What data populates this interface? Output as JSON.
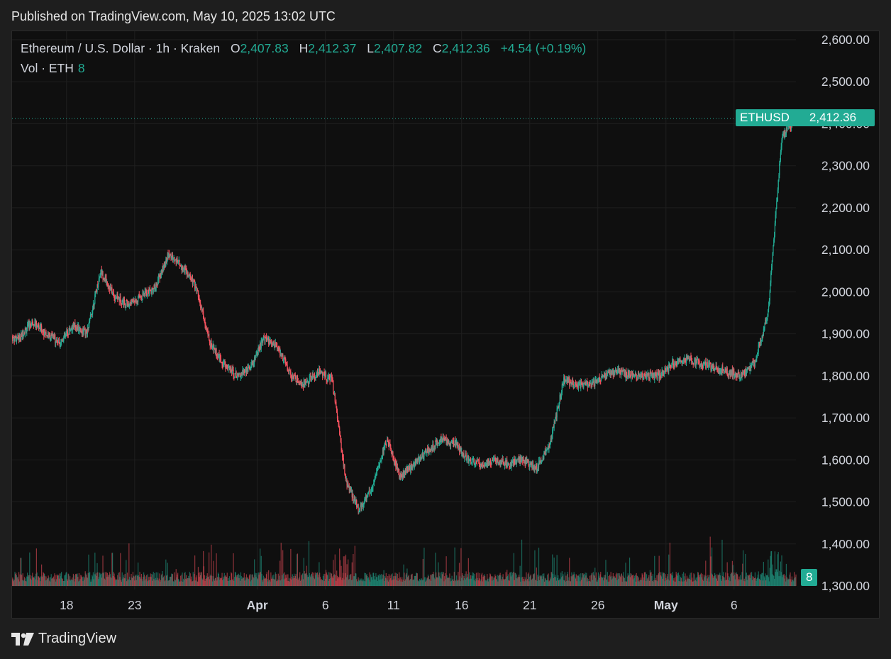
{
  "header": {
    "published_text": "Published on TradingView.com, May 10, 2025 13:02 UTC"
  },
  "legend": {
    "symbol_line": "Ethereum / U.S. Dollar · 1h · Kraken",
    "open_label": "O",
    "open": "2,407.83",
    "high_label": "H",
    "high": "2,412.37",
    "low_label": "L",
    "low": "2,407.82",
    "close_label": "C",
    "close": "2,412.36",
    "change": "+4.54 (+0.19%)",
    "volume_label": "Vol · ETH",
    "volume_value": "8"
  },
  "price_tags": {
    "symbol": "ETHUSD",
    "last_price": "2,412.36",
    "volume_tag": "8"
  },
  "footer": {
    "brand": "TradingView"
  },
  "colors": {
    "up": "#22ab94",
    "down": "#f7525f",
    "background": "#0f0f0f",
    "grid": "#1f1f1f",
    "text": "#d1d4dc"
  },
  "chart_data": {
    "type": "line",
    "subtype": "candlestick-with-volume",
    "x_ticks": [
      "18",
      "23",
      "Apr",
      "6",
      "11",
      "16",
      "21",
      "26",
      "May",
      "6"
    ],
    "x_tick_dates": [
      "2025-03-18",
      "2025-03-23",
      "2025-04-01",
      "2025-04-06",
      "2025-04-11",
      "2025-04-16",
      "2025-04-21",
      "2025-04-26",
      "2025-05-01",
      "2025-05-06"
    ],
    "y_ticks": [
      "2,600.00",
      "2,500.00",
      "2,400.00",
      "2,300.00",
      "2,200.00",
      "2,100.00",
      "2,000.00",
      "1,900.00",
      "1,800.00",
      "1,700.00",
      "1,600.00",
      "1,500.00",
      "1,400.00",
      "1,300.00"
    ],
    "ylim": [
      1300,
      2600
    ],
    "x_range": [
      "2025-03-14T00:00",
      "2025-05-10T13:00"
    ],
    "grid": true,
    "last_price": 2412.36,
    "series": [
      {
        "x": [
          "2025-03-14",
          "2025-03-15",
          "2025-03-16",
          "2025-03-17",
          "2025-03-18",
          "2025-03-19",
          "2025-03-20",
          "2025-03-21",
          "2025-03-22",
          "2025-03-23",
          "2025-03-24",
          "2025-03-25",
          "2025-03-26",
          "2025-03-27",
          "2025-03-28",
          "2025-03-29",
          "2025-03-30",
          "2025-03-31",
          "2025-04-01",
          "2025-04-02",
          "2025-04-03",
          "2025-04-04",
          "2025-04-05",
          "2025-04-06",
          "2025-04-07",
          "2025-04-08",
          "2025-04-09",
          "2025-04-10",
          "2025-04-11",
          "2025-04-12",
          "2025-04-13",
          "2025-04-14",
          "2025-04-15",
          "2025-04-16",
          "2025-04-17",
          "2025-04-18",
          "2025-04-19",
          "2025-04-20",
          "2025-04-21",
          "2025-04-22",
          "2025-04-23",
          "2025-04-24",
          "2025-04-25",
          "2025-04-26",
          "2025-04-27",
          "2025-04-28",
          "2025-04-29",
          "2025-04-30",
          "2025-05-01",
          "2025-05-02",
          "2025-05-03",
          "2025-05-04",
          "2025-05-05",
          "2025-05-06",
          "2025-05-07",
          "2025-05-08",
          "2025-05-09",
          "2025-05-10"
        ],
        "y": [
          1890,
          1930,
          1900,
          1880,
          1920,
          1900,
          2050,
          1990,
          1970,
          1990,
          2010,
          2090,
          2060,
          2010,
          1880,
          1830,
          1800,
          1820,
          1890,
          1870,
          1800,
          1780,
          1810,
          1790,
          1550,
          1480,
          1540,
          1650,
          1560,
          1590,
          1620,
          1650,
          1640,
          1600,
          1590,
          1600,
          1590,
          1600,
          1580,
          1640,
          1790,
          1780,
          1780,
          1800,
          1810,
          1800,
          1800,
          1800,
          1830,
          1840,
          1830,
          1820,
          1810,
          1800,
          1830,
          1950,
          2370,
          2410
        ]
      }
    ]
  }
}
